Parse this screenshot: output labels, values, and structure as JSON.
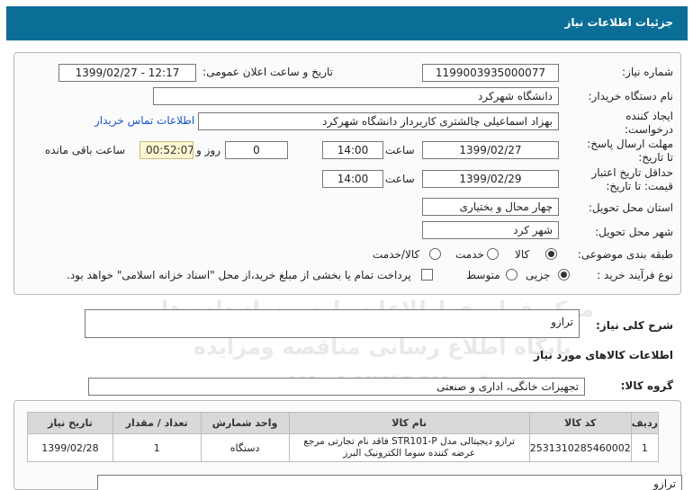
{
  "header": {
    "title": "جزئیات اطلاعات نیاز"
  },
  "fields": {
    "need_number_label": "شماره نیاز:",
    "need_number": "1199003935000077",
    "announce_label": "تاریخ و ساعت اعلان عمومی:",
    "announce_value": "1399/02/27 - 12:17",
    "buyer_label": "نام دستگاه خریدار:",
    "buyer_value": "دانشگاه شهرکرد",
    "creator_label": "ایجاد کننده درخواست:",
    "creator_value": "بهزاد اسماعیلی چالشتری کاربرداز دانشگاه شهرکرد",
    "contact_link": "اطلاعات تماس خریدار",
    "deadline_label": "مهلت ارسال پاسخ: تا تاریخ:",
    "deadline_date": "1399/02/27",
    "time_label": "ساعت",
    "deadline_time": "14:00",
    "days_value": "0",
    "days_label": "روز و",
    "timer_value": "00:52:07",
    "remaining_label": "ساعت باقی مانده",
    "validity_label": "حداقل تاریخ اعتبار قیمت: تا تاریخ:",
    "validity_date": "1399/02/29",
    "validity_time": "14:00",
    "province_label": "استان محل تحویل:",
    "province_value": "چهار محال و بختیاری",
    "city_label": "شهر محل تحویل:",
    "city_value": "شهر کرد",
    "category_label": "طبقه بندی موضوعی:",
    "category_options": [
      "کالا",
      "خدمت",
      "کالا/خدمت"
    ],
    "category_selected": "کالا",
    "process_label": "نوع فرآیند خرید :",
    "process_options": [
      "جزیی",
      "متوسط"
    ],
    "process_selected": "جزیی",
    "payment_note": "پرداخت تمام یا بخشی از مبلغ خرید،از محل \"اسناد خزانه اسلامی\" خواهد بود."
  },
  "summary": {
    "label": "شرح کلی نیاز:",
    "value": "ترازو"
  },
  "goods_info": {
    "title": "اطلاعات کالاهای مورد نیاز"
  },
  "goods_group": {
    "label": "گروه کالا:",
    "value": "تجهیزات خانگی، اداری و صنعتی"
  },
  "table": {
    "headers": [
      "ردیف",
      "کد کالا",
      "نام کالا",
      "واحد شمارش",
      "تعداد / مقدار",
      "تاریخ نیاز"
    ],
    "rows": [
      [
        "1",
        "2531310285460002",
        "ترازو دیجیتالی مدل STR101-P فاقد نام تجارتی مرجع عرضه کننده سوما الکترونیک البرز",
        "دستگاه",
        "1",
        "1399/02/28"
      ]
    ]
  },
  "footer_box": {
    "value": "ترازو"
  },
  "watermark": {
    "line1": "مرکز فراوری اطلاعات پارس نماد داده ها",
    "line2": "پایگاه اطلاع رسانی مناقصه ومزایده",
    "line3": "۰۲۱-۸۸۳۴۹۶۷۰-۵"
  }
}
